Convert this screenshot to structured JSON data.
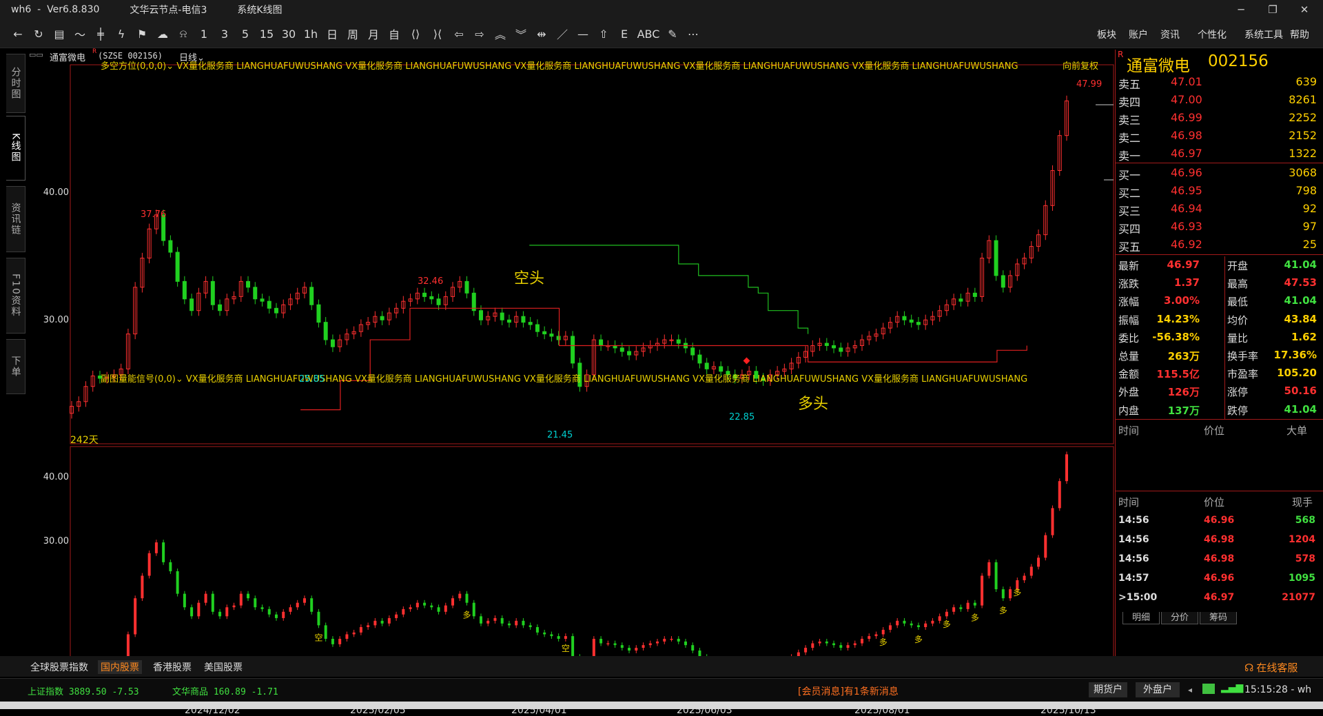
{
  "window": {
    "app": "wh6",
    "version": "Ver6.8.830",
    "node": "文华云节点-电信3",
    "view": "系统K线图",
    "min": "─",
    "max": "❐",
    "close": "✕"
  },
  "toolbar": {
    "icons": [
      {
        "name": "back-icon",
        "glyph": "←"
      },
      {
        "name": "refresh-icon",
        "glyph": "↻"
      },
      {
        "name": "table-icon",
        "glyph": "▤"
      },
      {
        "name": "line-chart-icon",
        "glyph": "〜"
      },
      {
        "name": "candlestick-icon",
        "glyph": "╪"
      },
      {
        "name": "tick-chart-icon",
        "glyph": "ϟ"
      },
      {
        "name": "flag-icon",
        "glyph": "⚑"
      },
      {
        "name": "cloud-refresh-icon",
        "glyph": "☁"
      },
      {
        "name": "bell-icon",
        "glyph": "⍾"
      },
      {
        "name": "period-1",
        "glyph": "1"
      },
      {
        "name": "period-3",
        "glyph": "3"
      },
      {
        "name": "period-5",
        "glyph": "5"
      },
      {
        "name": "period-15",
        "glyph": "15"
      },
      {
        "name": "period-30",
        "glyph": "30"
      },
      {
        "name": "period-1h",
        "glyph": "1h"
      },
      {
        "name": "period-day",
        "glyph": "日"
      },
      {
        "name": "period-week",
        "glyph": "周"
      },
      {
        "name": "period-month",
        "glyph": "月"
      },
      {
        "name": "period-custom",
        "glyph": "自"
      },
      {
        "name": "zoom-in-icon",
        "glyph": "⟨⟩"
      },
      {
        "name": "zoom-out-icon",
        "glyph": "⟩⟨"
      },
      {
        "name": "arrow-left-icon",
        "glyph": "⇦"
      },
      {
        "name": "arrow-right-icon",
        "glyph": "⇨"
      },
      {
        "name": "arrow-up-icon",
        "glyph": "︽"
      },
      {
        "name": "arrow-down-icon",
        "glyph": "︾"
      },
      {
        "name": "crosshair-icon",
        "glyph": "⇹"
      },
      {
        "name": "draw-line-icon",
        "glyph": "／"
      },
      {
        "name": "hline-icon",
        "glyph": "—"
      },
      {
        "name": "home-icon",
        "glyph": "⇧"
      },
      {
        "name": "e-icon",
        "glyph": "E"
      },
      {
        "name": "abc-icon",
        "glyph": "ABC"
      },
      {
        "name": "pen-icon",
        "glyph": "✎"
      },
      {
        "name": "more-icon",
        "glyph": "⋯"
      }
    ],
    "menu": [
      "板块",
      "账户",
      "资讯",
      "个性化",
      "系统工具",
      "帮助"
    ]
  },
  "left_tabs": [
    {
      "label": "分时图",
      "active": false
    },
    {
      "label": "K线图",
      "active": true
    },
    {
      "label": "资讯链",
      "active": false
    },
    {
      "label": "F10资料",
      "active": false
    },
    {
      "label": "下单",
      "active": false
    }
  ],
  "chart_header": {
    "grid_icon": "▭▭",
    "symbol": "通富微电",
    "code": "(SZSE 002156)",
    "period": "日线",
    "dropdown": "⌄"
  },
  "indicators": {
    "main": "多空方位(0,0,0)⌄  VX量化服务商  LIANGHUAFUWUSHANG  VX量化服务商  LIANGHUAFUWUSHANG  VX量化服务商  LIANGHUAFUWUSHANG  VX量化服务商  LIANGHUAFUWUSHANG  VX量化服务商  LIANGHUAFUWUSHANG",
    "sub": "副图量能信号(0,0)⌄  VX量化服务商  LIANGHUAFUWUSHANG  VX量化服务商  LIANGHUAFUWUSHANG  VX量化服务商  LIANGHUAFUWUSHANG  VX量化服务商  LIANGHUAFUWUSHANG  VX量化服务商  LIANGHUAFUWUSHANG",
    "adjust": "向前复权"
  },
  "chart_data": {
    "type": "candlestick",
    "symbol": "通富微电",
    "period": "日线",
    "bars_count_label": "242天",
    "y_ticks_main": [
      "40.00",
      "30.00"
    ],
    "y_ticks_sub": [
      "40.00",
      "30.00"
    ],
    "x_ticks": [
      "2024/12/02",
      "2025/02/05",
      "2025/04/01",
      "2025/06/03",
      "2025/08/01",
      "2025/10/13"
    ],
    "annotations": [
      {
        "text": "37.76"
      },
      {
        "text": "32.46"
      },
      {
        "text": "25.85"
      },
      {
        "text": "21.45"
      },
      {
        "text": "22.85"
      },
      {
        "text": "47.99"
      }
    ],
    "labels": {
      "short": "空头",
      "long": "多头"
    },
    "sub_markers": {
      "bull": "多",
      "bear": "空"
    },
    "closes": [
      20.8,
      21.2,
      22.5,
      23.4,
      23.2,
      23.3,
      23.5,
      24.0,
      27.0,
      31.0,
      33.5,
      36.0,
      37.2,
      35.0,
      34.0,
      31.5,
      30.0,
      29.0,
      30.5,
      31.5,
      29.5,
      29.0,
      30.0,
      30.2,
      31.5,
      31.0,
      30.0,
      29.8,
      29.2,
      28.8,
      29.5,
      30.0,
      30.5,
      31.0,
      29.5,
      28.0,
      26.5,
      25.9,
      26.5,
      27.0,
      27.2,
      27.8,
      28.0,
      28.5,
      28.2,
      28.8,
      29.2,
      29.8,
      30.0,
      30.5,
      30.2,
      30.0,
      29.5,
      30.2,
      31.0,
      31.5,
      30.5,
      29.0,
      28.2,
      28.5,
      28.8,
      28.2,
      28.0,
      28.5,
      28.0,
      27.8,
      27.2,
      27.0,
      26.8,
      26.5,
      26.8,
      24.5,
      22.5,
      23.5,
      26.5,
      26.0,
      26.0,
      25.8,
      25.5,
      25.2,
      25.5,
      25.8,
      26.0,
      26.2,
      26.5,
      26.5,
      26.2,
      25.8,
      25.2,
      24.5,
      24.0,
      24.2,
      23.8,
      23.5,
      23.2,
      23.5,
      23.8,
      23.2,
      23.0,
      23.5,
      23.8,
      24.0,
      24.5,
      25.0,
      25.5,
      26.0,
      26.2,
      26.0,
      25.8,
      25.5,
      25.8,
      26.0,
      26.5,
      26.8,
      27.0,
      27.5,
      28.0,
      28.5,
      28.2,
      28.0,
      27.8,
      28.2,
      28.5,
      29.0,
      29.5,
      30.0,
      29.8,
      30.5,
      30.2,
      33.5,
      35.0,
      32.0,
      31.0,
      32.0,
      33.0,
      33.5,
      34.5,
      35.5,
      38.0,
      41.0,
      44.0,
      46.97
    ],
    "bull_line": {
      "color": "#e02020",
      "points": [
        [
          0.23,
          20.5
        ],
        [
          0.27,
          23.0
        ],
        [
          0.3,
          26.5
        ],
        [
          0.34,
          29.2
        ],
        [
          0.49,
          29.2
        ],
        [
          0.49,
          26.0
        ],
        [
          0.74,
          25.0
        ],
        [
          0.74,
          24.6
        ],
        [
          0.9,
          24.6
        ],
        [
          0.93,
          25.6
        ],
        [
          0.96,
          26.0
        ]
      ]
    },
    "bear_line": {
      "color": "#20c020",
      "points": [
        [
          0.46,
          34.6
        ],
        [
          0.59,
          34.6
        ],
        [
          0.61,
          33.0
        ],
        [
          0.63,
          32.0
        ],
        [
          0.68,
          31.0
        ],
        [
          0.69,
          30.5
        ],
        [
          0.7,
          29.0
        ],
        [
          0.73,
          27.5
        ],
        [
          0.74,
          27.0
        ]
      ]
    }
  },
  "quote": {
    "flag": "R",
    "name": "通富微电",
    "code": "002156",
    "asks": [
      {
        "label": "卖五",
        "price": "47.01",
        "vol": "639"
      },
      {
        "label": "卖四",
        "price": "47.00",
        "vol": "8261"
      },
      {
        "label": "卖三",
        "price": "46.99",
        "vol": "2252"
      },
      {
        "label": "卖二",
        "price": "46.98",
        "vol": "2152"
      },
      {
        "label": "卖一",
        "price": "46.97",
        "vol": "1322"
      }
    ],
    "bids": [
      {
        "label": "买一",
        "price": "46.96",
        "vol": "3068"
      },
      {
        "label": "买二",
        "price": "46.95",
        "vol": "798"
      },
      {
        "label": "买三",
        "price": "46.94",
        "vol": "92"
      },
      {
        "label": "买四",
        "price": "46.93",
        "vol": "97"
      },
      {
        "label": "买五",
        "price": "46.92",
        "vol": "25"
      }
    ],
    "stats_left": [
      {
        "label": "最新",
        "value": "46.97",
        "color": "#ff3030"
      },
      {
        "label": "涨跌",
        "value": "1.37",
        "color": "#ff3030"
      },
      {
        "label": "涨幅",
        "value": "3.00%",
        "color": "#ff3030"
      },
      {
        "label": "振幅",
        "value": "14.23%",
        "color": "#ffd000"
      },
      {
        "label": "委比",
        "value": "-56.38%",
        "color": "#ffd000"
      },
      {
        "label": "总量",
        "value": "263万",
        "color": "#ffd000"
      },
      {
        "label": "金额",
        "value": "115.5亿",
        "color": "#ff3030"
      },
      {
        "label": "外盘",
        "value": "126万",
        "color": "#ff3030"
      },
      {
        "label": "内盘",
        "value": "137万",
        "color": "#40e040"
      }
    ],
    "stats_right": [
      {
        "label": "开盘",
        "value": "41.04",
        "color": "#40e040"
      },
      {
        "label": "最高",
        "value": "47.53",
        "color": "#ff3030"
      },
      {
        "label": "最低",
        "value": "41.04",
        "color": "#40e040"
      },
      {
        "label": "均价",
        "value": "43.84",
        "color": "#ffd000"
      },
      {
        "label": "量比",
        "value": "1.62",
        "color": "#ffd000"
      },
      {
        "label": "换手率",
        "value": "17.36%",
        "color": "#ffd000"
      },
      {
        "label": "市盈率",
        "value": "105.20",
        "color": "#ffd000"
      },
      {
        "label": "涨停",
        "value": "50.16",
        "color": "#ff3030"
      },
      {
        "label": "跌停",
        "value": "41.04",
        "color": "#40e040"
      }
    ],
    "big_header": [
      "时间",
      "价位",
      "大单"
    ],
    "trades_header": [
      "时间",
      "价位",
      "现手"
    ],
    "trades": [
      {
        "time": "14:56",
        "price": "46.96",
        "vol": "568",
        "vcolor": "#40e040"
      },
      {
        "time": "14:56",
        "price": "46.98",
        "vol": "1204",
        "vcolor": "#ff3030"
      },
      {
        "time": "14:56",
        "price": "46.98",
        "vol": "578",
        "vcolor": "#ff3030"
      },
      {
        "time": "14:57",
        "price": "46.96",
        "vol": "1095",
        "vcolor": "#40e040"
      },
      {
        "time": ">15:00",
        "price": "46.97",
        "vol": "21077",
        "vcolor": "#ff3030"
      }
    ],
    "tabs": [
      "明细",
      "分价",
      "筹码"
    ]
  },
  "bottom_tabs": [
    {
      "label": "全球股票指数",
      "active": false
    },
    {
      "label": "国内股票",
      "active": true
    },
    {
      "label": "香港股票",
      "active": false
    },
    {
      "label": "美国股票",
      "active": false
    }
  ],
  "service": {
    "icon": "headset-icon",
    "label": "在线客服"
  },
  "status": {
    "idx1_name": "上证指数",
    "idx1_val": "3889.50",
    "idx1_chg": "-7.53",
    "idx2_name": "文华商品",
    "idx2_val": "160.89",
    "idx2_chg": "-1.71",
    "message": "[会员消息]有1条新消息",
    "btn1": "期货户",
    "btn2": "外盘户",
    "time": "15:15:28 - wh"
  },
  "colors": {
    "up": "#ff3030",
    "down": "#20d020",
    "border": "#a31a1a",
    "yellow": "#ffd000"
  }
}
